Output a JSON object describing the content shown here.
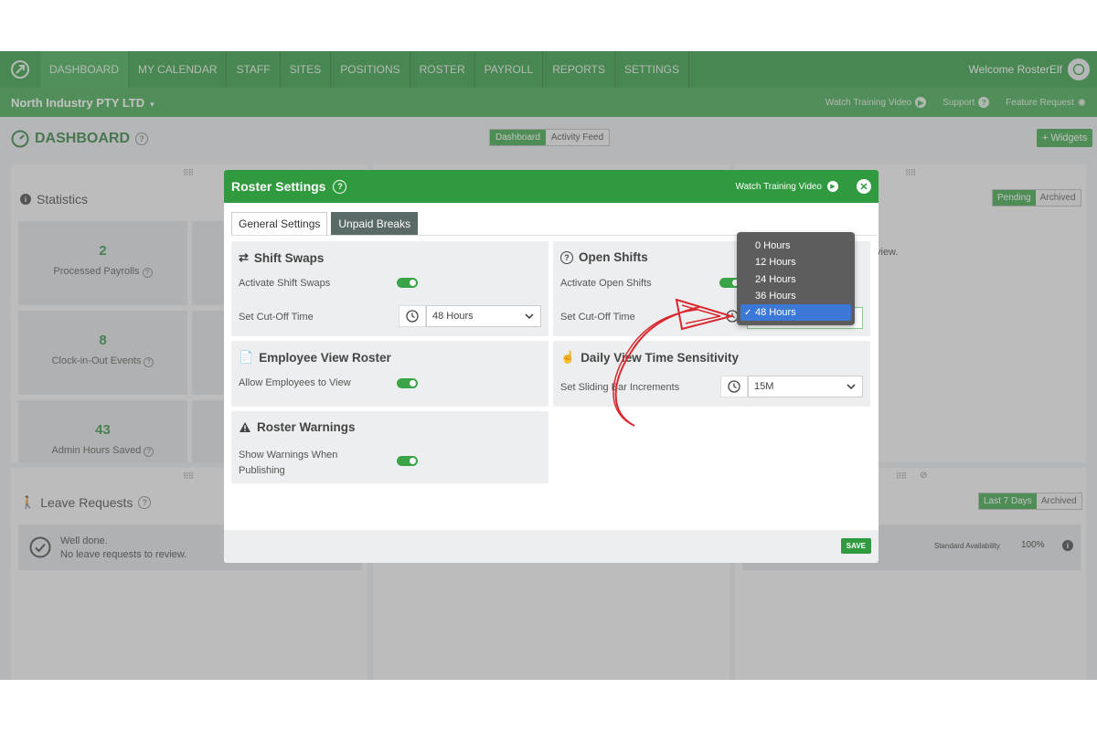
{
  "nav": {
    "items": [
      "DASHBOARD",
      "MY CALENDAR",
      "STAFF",
      "SITES",
      "POSITIONS",
      "ROSTER",
      "PAYROLL",
      "REPORTS",
      "SETTINGS"
    ],
    "welcome": "Welcome RosterElf"
  },
  "subbar": {
    "org": "North Industry PTY LTD",
    "watch": "Watch Training Video",
    "support": "Support",
    "feature": "Feature Request"
  },
  "dashboard": {
    "title": "DASHBOARD",
    "toggle": [
      "Dashboard",
      "Activity Feed"
    ],
    "widgets_btn": "+ Widgets",
    "statistics_title": "Statistics",
    "stats": [
      {
        "value": "2",
        "label": "Processed Payrolls"
      },
      {
        "value": "8",
        "label": "Clock-in-Out Events"
      },
      {
        "value": "43",
        "label": "Admin Hours Saved"
      }
    ],
    "right_toggle": [
      "Pending",
      "Archived"
    ],
    "right_text": "view.",
    "leave_title": "Leave Requests",
    "leave_msg1": "Well done.",
    "leave_msg2": "No leave requests to review.",
    "bottom_toggle": [
      "Last 7 Days",
      "Archived"
    ],
    "availability_label": "Standard Availability",
    "availability_value": "100%"
  },
  "modal": {
    "title": "Roster Settings",
    "watch": "Watch Training Video",
    "tabs": [
      "General Settings",
      "Unpaid Breaks"
    ],
    "shift_swaps": {
      "title": "Shift Swaps",
      "activate": "Activate Shift Swaps",
      "cutoff": "Set Cut-Off Time",
      "cutoff_value": "48 Hours"
    },
    "open_shifts": {
      "title": "Open Shifts",
      "activate": "Activate Open Shifts",
      "cutoff": "Set Cut-Off Time"
    },
    "employee_view": {
      "title": "Employee View Roster",
      "allow": "Allow Employees to View"
    },
    "daily_view": {
      "title": "Daily View Time Sensitivity",
      "sliding": "Set Sliding Bar Increments",
      "sliding_value": "15M"
    },
    "warnings": {
      "title": "Roster Warnings",
      "show1": "Show Warnings When",
      "show2": "Publishing"
    },
    "save": "SAVE"
  },
  "dropdown": {
    "options": [
      "0 Hours",
      "12 Hours",
      "24 Hours",
      "36 Hours",
      "48 Hours"
    ],
    "selected": "48 Hours"
  },
  "colors": {
    "brand": "#2f9a3e",
    "selected": "#3b78d8",
    "arrow": "#d9282f"
  }
}
